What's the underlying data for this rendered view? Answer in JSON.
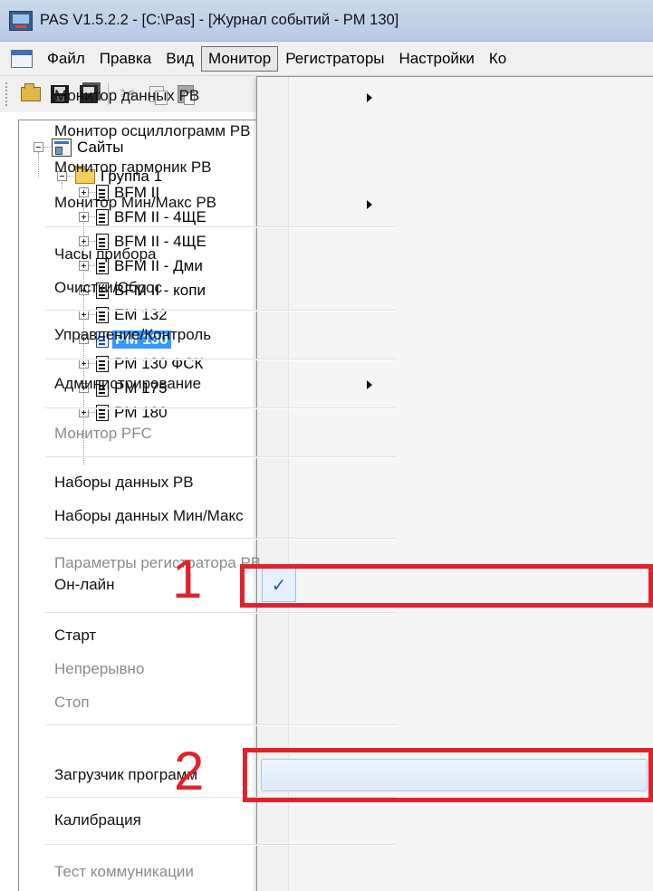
{
  "window": {
    "title": "PAS V1.5.2.2 - [C:\\Pas] - [Журнал событий - PM 130]"
  },
  "menubar": {
    "items": [
      "Файл",
      "Правка",
      "Вид",
      "Монитор",
      "Регистраторы",
      "Настройки",
      "Ко"
    ],
    "active": "Монитор"
  },
  "toolbar": {
    "buttons": [
      "open-icon",
      "save-icon",
      "save-all-icon",
      "cut-icon",
      "copy-icon",
      "paste-icon"
    ]
  },
  "tree": {
    "root": "Сайты",
    "group": "Группа 1",
    "devices": [
      "BFM II",
      "BFM II - 4ЩЕ",
      "BFM II - 4ЩЕ",
      "BFM II - Дми",
      "BFM II - копи",
      "EM 132",
      "PM 130",
      "PM 130 ФСК",
      "PM 175",
      "PM 180"
    ],
    "selected": "PM 130"
  },
  "dropdown": {
    "items": {
      "data_monitor": "Монитор данных PB",
      "osc_monitor": "Монитор осциллограмм PB",
      "harm_monitor": "Монитор гармоник PB",
      "minmax_monitor": "Монитор Мин/Макс PB",
      "clock": "Часы прибора",
      "clear_reset": "Очистки/Сброс",
      "control": "Управление/Контроль",
      "admin": "Администрирование",
      "pfc_monitor": "Монитор PFC",
      "data_sets": "Наборы данных PB",
      "minmax_sets": "Наборы данных Мин/Макс",
      "recorder_params": "Параметры регистратора PB",
      "online": "Он-лайн",
      "start": "Старт",
      "continuous": "Непрерывно",
      "stop": "Стоп",
      "loader": "Загрузчик программ",
      "calibration": "Калибрация",
      "comm_test": "Тест коммуникации"
    },
    "checkmark": "✓"
  },
  "annotations": {
    "marker1": "1",
    "marker2": "2",
    "color": "#e3212b"
  }
}
